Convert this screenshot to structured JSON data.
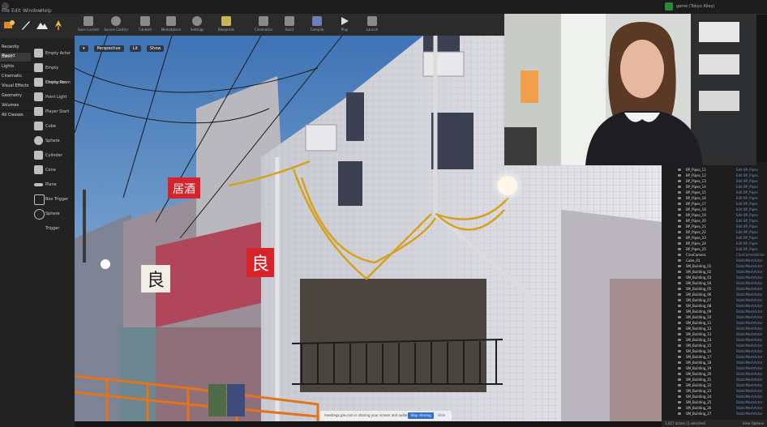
{
  "menu": {
    "items": [
      "File",
      "Edit",
      "Window",
      "Help"
    ],
    "project_title": "game (Tokyo Alley)"
  },
  "left_panel": {
    "categories": [
      "Recently Placed",
      "Basic",
      "Lights",
      "Cinematic",
      "Visual Effects",
      "Geometry",
      "Volumes",
      "All Classes"
    ],
    "active_category": 1,
    "place_items": [
      "Empty Actor",
      "Empty Character",
      "Empty Pawn",
      "Point Light",
      "Player Start",
      "Cube",
      "Sphere",
      "Cylinder",
      "Cone",
      "Plane",
      "Box Trigger",
      "Sphere Trigger"
    ]
  },
  "toolbar": {
    "buttons": [
      "Save Current",
      "Source Control",
      "Content",
      "Marketplace",
      "Settings",
      "Blueprints",
      "Cinematics",
      "Build",
      "Compile",
      "Play",
      "Launch"
    ]
  },
  "viewport": {
    "controls": [
      "Perspective",
      "Lit",
      "Show"
    ],
    "signs": [
      "良",
      "良",
      "居酒"
    ]
  },
  "outliner": {
    "rows": [
      {
        "name": "BP_Pipes_11",
        "type": "Edit BP_Pipes"
      },
      {
        "name": "BP_Pipes_12",
        "type": "Edit BP_Pipes"
      },
      {
        "name": "BP_Pipes_13",
        "type": "Edit BP_Pipes"
      },
      {
        "name": "BP_Pipes_14",
        "type": "Edit BP_Pipes"
      },
      {
        "name": "BP_Pipes_15",
        "type": "Edit BP_Pipes"
      },
      {
        "name": "BP_Pipes_16",
        "type": "Edit BP_Pipes"
      },
      {
        "name": "BP_Pipes_17",
        "type": "Edit BP_Pipes"
      },
      {
        "name": "BP_Pipes_18",
        "type": "Edit BP_Pipes"
      },
      {
        "name": "BP_Pipes_19",
        "type": "Edit BP_Pipes"
      },
      {
        "name": "BP_Pipes_20",
        "type": "Edit BP_Pipes"
      },
      {
        "name": "BP_Pipes_21",
        "type": "Edit BP_Pipes"
      },
      {
        "name": "BP_Pipes_22",
        "type": "Edit BP_Pipes"
      },
      {
        "name": "BP_Pipes_23",
        "type": "Edit BP_Pipes"
      },
      {
        "name": "BP_Pipes_24",
        "type": "Edit BP_Pipes"
      },
      {
        "name": "BP_Pipes_25",
        "type": "Edit BP_Pipes"
      },
      {
        "name": "CineCamera",
        "type": "CineCameraActor"
      },
      {
        "name": "Cube_01",
        "type": "StaticMeshActor"
      },
      {
        "name": "SM_Building_01",
        "type": "StaticMeshActor"
      },
      {
        "name": "SM_Building_02",
        "type": "StaticMeshActor"
      },
      {
        "name": "SM_Building_03",
        "type": "StaticMeshActor"
      },
      {
        "name": "SM_Building_04",
        "type": "StaticMeshActor"
      },
      {
        "name": "SM_Building_05",
        "type": "StaticMeshActor"
      },
      {
        "name": "SM_Building_06",
        "type": "StaticMeshActor"
      },
      {
        "name": "SM_Building_07",
        "type": "StaticMeshActor"
      },
      {
        "name": "SM_Building_08",
        "type": "StaticMeshActor"
      },
      {
        "name": "SM_Building_09",
        "type": "StaticMeshActor"
      },
      {
        "name": "SM_Building_10",
        "type": "StaticMeshActor"
      },
      {
        "name": "SM_Building_11",
        "type": "StaticMeshActor"
      },
      {
        "name": "SM_Building_12",
        "type": "StaticMeshActor"
      },
      {
        "name": "SM_Building_13",
        "type": "StaticMeshActor"
      },
      {
        "name": "SM_Building_14",
        "type": "StaticMeshActor"
      },
      {
        "name": "SM_Building_15",
        "type": "StaticMeshActor"
      },
      {
        "name": "SM_Building_16",
        "type": "StaticMeshActor"
      },
      {
        "name": "SM_Building_17",
        "type": "StaticMeshActor"
      },
      {
        "name": "SM_Building_18",
        "type": "StaticMeshActor"
      },
      {
        "name": "SM_Building_19",
        "type": "StaticMeshActor"
      },
      {
        "name": "SM_Building_20",
        "type": "StaticMeshActor"
      },
      {
        "name": "SM_Building_21",
        "type": "StaticMeshActor"
      },
      {
        "name": "SM_Building_22",
        "type": "StaticMeshActor"
      },
      {
        "name": "SM_Building_23",
        "type": "StaticMeshActor"
      },
      {
        "name": "SM_Building_24",
        "type": "StaticMeshActor"
      },
      {
        "name": "SM_Building_25",
        "type": "StaticMeshActor"
      },
      {
        "name": "SM_Building_26",
        "type": "StaticMeshActor"
      },
      {
        "name": "SM_Building_27",
        "type": "StaticMeshActor"
      }
    ],
    "footer": "1,027 actors (1 selected)",
    "footer_right": "View Options"
  },
  "notification": {
    "text": "meetings.gle.com is sharing your screen and audio",
    "share_label": "Stop sharing",
    "hide_label": "Hide"
  },
  "colors": {
    "sky_top": "#3f73b5",
    "sky_low": "#9ec4e0",
    "wall": "#d8d8dc",
    "sign_red": "#d8232a",
    "cable": "#d6a11f",
    "fence": "#e3731c",
    "outliner_type": "#6f93c9"
  }
}
